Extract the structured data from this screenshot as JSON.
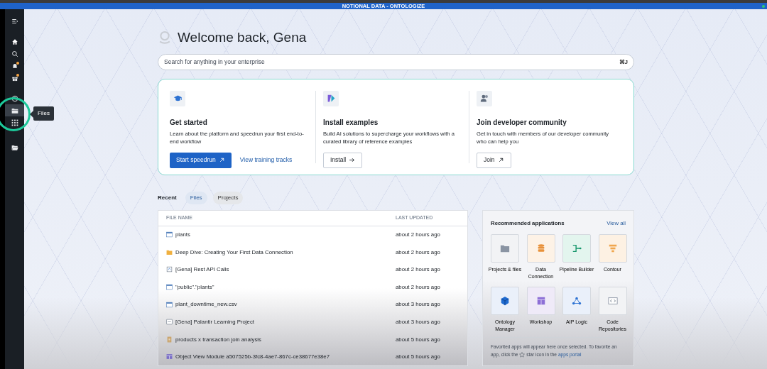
{
  "app_bar": {
    "title": "NOTIONAL DATA - ONTOLOGIZE"
  },
  "sidebar": {
    "items": [
      {
        "kind": "menu",
        "selected": false,
        "notification": false
      },
      {
        "kind": "home",
        "selected": false,
        "notification": false
      },
      {
        "kind": "search",
        "selected": false,
        "notification": false
      },
      {
        "kind": "bell",
        "selected": false,
        "notification": true
      },
      {
        "kind": "gift",
        "selected": false,
        "notification": true
      },
      {
        "kind": "clock",
        "selected": false,
        "notification": false
      },
      {
        "kind": "files",
        "selected": true,
        "notification": false
      },
      {
        "kind": "apps",
        "selected": false,
        "notification": false
      },
      {
        "kind": "folder",
        "selected": false,
        "notification": false
      }
    ],
    "tooltip": "Files"
  },
  "welcome": "Welcome back, Gena",
  "search": {
    "placeholder": "Search for anything in your enterprise",
    "shortcut": "⌘J"
  },
  "cards": [
    {
      "title": "Get started",
      "description": "Learn about the platform and speedrun your first end-to-end workflow",
      "buttons": [
        {
          "label": "Start speedrun",
          "kind": "primary"
        },
        {
          "label": "View training tracks",
          "kind": "link"
        }
      ]
    },
    {
      "title": "Install examples",
      "description": "Build AI solutions to supercharge your workflows with a curated library of reference examples",
      "buttons": [
        {
          "label": "Install",
          "kind": "outline"
        }
      ]
    },
    {
      "title": "Join developer community",
      "description": "Get in touch with members of our developer community who can help you",
      "buttons": [
        {
          "label": "Join",
          "kind": "outline"
        }
      ]
    }
  ],
  "recent": {
    "label": "Recent",
    "tabs": [
      {
        "label": "Files",
        "selected": true
      },
      {
        "label": "Projects",
        "selected": false
      }
    ]
  },
  "table": {
    "columns": [
      "FILE NAME",
      "LAST UPDATED"
    ],
    "rows": [
      {
        "kind": "dataset",
        "name": "plants",
        "updated": "about 2 hours ago"
      },
      {
        "kind": "folder",
        "name": "Deep Dive: Creating Your First Data Connection",
        "updated": "about 2 hours ago"
      },
      {
        "kind": "notebook",
        "name": "[Gena] Rest API Calls",
        "updated": "about 2 hours ago"
      },
      {
        "kind": "dataset",
        "name": "\"public\".\"plants\"",
        "updated": "about 2 hours ago"
      },
      {
        "kind": "dataset",
        "name": "plant_downtime_new.csv",
        "updated": "about 3 hours ago"
      },
      {
        "kind": "project",
        "name": "[Gena] Palantir Learning Project",
        "updated": "about 3 hours ago"
      },
      {
        "kind": "analysis",
        "name": "products x transaction join analysis",
        "updated": "about 5 hours ago"
      },
      {
        "kind": "module",
        "name": "Object View Module a507525b-3fc8-4ae7-867c-ce38677e38e7",
        "updated": "about 5 hours ago"
      }
    ]
  },
  "recommended": {
    "title": "Recommended applications",
    "view_all": "View all",
    "apps": [
      {
        "kind": "files",
        "label": "Projects & files"
      },
      {
        "kind": "database",
        "label": "Data Connection"
      },
      {
        "kind": "pipeline",
        "label": "Pipeline Builder"
      },
      {
        "kind": "funnel",
        "label": "Contour"
      },
      {
        "kind": "cube",
        "label": "Ontology Manager"
      },
      {
        "kind": "layout",
        "label": "Workshop"
      },
      {
        "kind": "nodes",
        "label": "AIP Logic"
      },
      {
        "kind": "code",
        "label": "Code Repositories"
      }
    ],
    "footer_before": "Favorited apps will appear here once selected. To favorite an app, click the",
    "footer_after": "star icon in the",
    "footer_link": "apps portal"
  }
}
